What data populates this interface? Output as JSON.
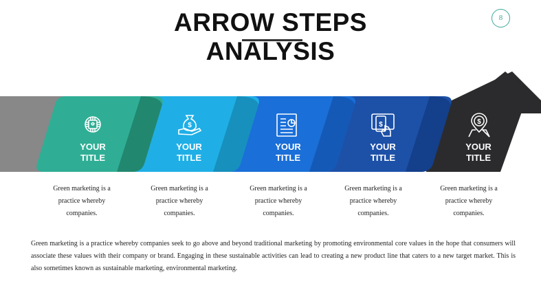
{
  "slide": {
    "title_line1": "ARROW STEPS",
    "title_line2": "ANALYSIS",
    "page_number": "8"
  },
  "colors": {
    "gray": "#888888",
    "teal": "#2fae95",
    "sky": "#1fafe6",
    "blue": "#1a6fd8",
    "navy": "#1d51a8",
    "dark": "#2b2b2d"
  },
  "steps": [
    {
      "icon": "microchip-icon",
      "title_line1": "YOUR",
      "title_line2": "TITLE",
      "desc_line1": "Green marketing is a",
      "desc_line2": "practice whereby",
      "desc_line3": "companies."
    },
    {
      "icon": "money-bag-hand-icon",
      "title_line1": "YOUR",
      "title_line2": "TITLE",
      "desc_line1": "Green marketing is a",
      "desc_line2": "practice whereby",
      "desc_line3": "companies."
    },
    {
      "icon": "report-document-icon",
      "title_line1": "YOUR",
      "title_line2": "TITLE",
      "desc_line1": "Green marketing is a",
      "desc_line2": "practice whereby",
      "desc_line3": "companies."
    },
    {
      "icon": "mobile-payment-icon",
      "title_line1": "YOUR",
      "title_line2": "TITLE",
      "desc_line1": "Green marketing is a",
      "desc_line2": "practice whereby",
      "desc_line3": "companies."
    },
    {
      "icon": "dollar-location-pin-icon",
      "title_line1": "YOUR",
      "title_line2": "TITLE",
      "desc_line1": "Green marketing is a",
      "desc_line2": "practice whereby",
      "desc_line3": "companies."
    }
  ],
  "body_text": "Green marketing is a practice whereby companies seek to go above and beyond traditional marketing by promoting environmental core values in the hope that consumers will associate these values with their company or brand. Engaging in these sustainable activities can lead to creating a new product line that caters to a new target market. This is also sometimes known as sustainable marketing, environmental marketing."
}
